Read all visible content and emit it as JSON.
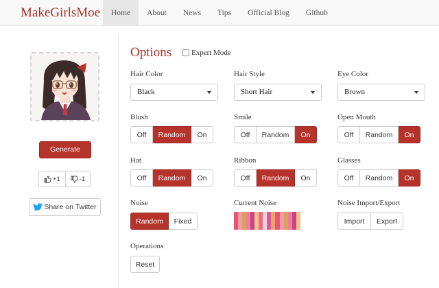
{
  "brand": "MakeGirlsMoe",
  "nav": [
    {
      "label": "Home",
      "active": true
    },
    {
      "label": "About"
    },
    {
      "label": "News"
    },
    {
      "label": "Tips"
    },
    {
      "label": "Official Blog"
    },
    {
      "label": "Github"
    }
  ],
  "sidebar": {
    "generate_label": "Generate",
    "upvote_label": "+1",
    "downvote_label": "-1",
    "twitter_label": "Share on Twitter"
  },
  "options": {
    "title": "Options",
    "expert_mode_label": "Expert Mode",
    "expert_mode_checked": false,
    "hair_color": {
      "label": "Hair Color",
      "value": "Black"
    },
    "hair_style": {
      "label": "Hair Style",
      "value": "Short Hair"
    },
    "eye_color": {
      "label": "Eye Color",
      "value": "Brown"
    },
    "blush": {
      "label": "Blush",
      "choices": [
        "Off",
        "Random",
        "On"
      ],
      "selected": "Random"
    },
    "smile": {
      "label": "Smile",
      "choices": [
        "Off",
        "Random",
        "On"
      ],
      "selected": "On"
    },
    "open_mouth": {
      "label": "Open Mouth",
      "choices": [
        "Off",
        "Random",
        "On"
      ],
      "selected": "On"
    },
    "hat": {
      "label": "Hat",
      "choices": [
        "Off",
        "Random",
        "On"
      ],
      "selected": "Random"
    },
    "ribbon": {
      "label": "Ribbon",
      "choices": [
        "Off",
        "Random",
        "On"
      ],
      "selected": "Random"
    },
    "glasses": {
      "label": "Glasses",
      "choices": [
        "Off",
        "Random",
        "On"
      ],
      "selected": "On"
    },
    "noise": {
      "label": "Noise",
      "choices": [
        "Random",
        "Fixed"
      ],
      "selected": "Random"
    },
    "current_noise_label": "Current Noise",
    "noise_io": {
      "label": "Noise Import/Export",
      "import_label": "Import",
      "export_label": "Export"
    },
    "operations": {
      "label": "Operations",
      "reset_label": "Reset"
    }
  },
  "colors": {
    "accent": "#b5332a",
    "brand": "#a8322b",
    "noise_palette": [
      "#e8556f",
      "#f49ab0",
      "#d9a25c",
      "#f07e95",
      "#c9438a",
      "#f5c08a",
      "#ea6f86",
      "#fbd0db",
      "#d65a9a",
      "#eda46a"
    ]
  }
}
